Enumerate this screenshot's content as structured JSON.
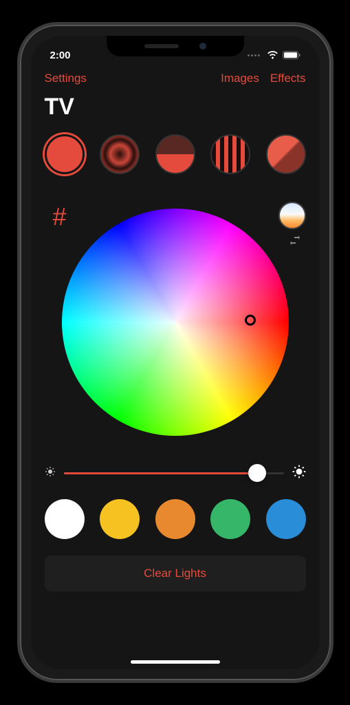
{
  "status": {
    "time": "2:00"
  },
  "nav": {
    "settings": "Settings",
    "images": "Images",
    "effects": "Effects"
  },
  "title": "TV",
  "brightness": {
    "value": 88
  },
  "swatches": [
    {
      "name": "white",
      "color": "#ffffff"
    },
    {
      "name": "yellow",
      "color": "#f5c221"
    },
    {
      "name": "orange",
      "color": "#e88930"
    },
    {
      "name": "green",
      "color": "#35b668"
    },
    {
      "name": "blue",
      "color": "#2a8dd8"
    }
  ],
  "patterns": [
    {
      "name": "solid",
      "active": true
    },
    {
      "name": "radial",
      "active": false
    },
    {
      "name": "half",
      "active": false
    },
    {
      "name": "stripes",
      "active": false
    },
    {
      "name": "diagonal",
      "active": false
    }
  ],
  "accent_color": "#e54b3c",
  "clear_button": "Clear Lights"
}
